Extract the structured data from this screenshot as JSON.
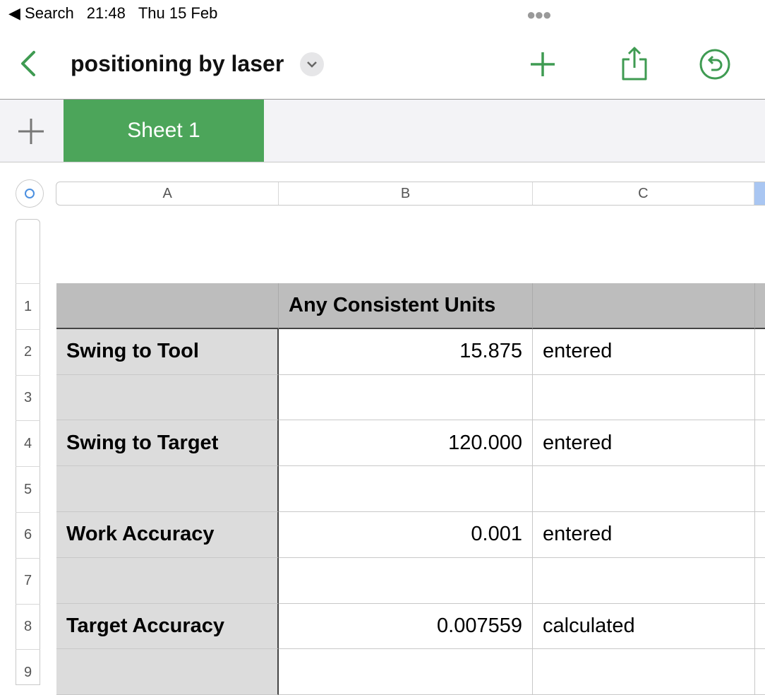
{
  "status": {
    "back_app": "Search",
    "time": "21:48",
    "date": "Thu 15 Feb"
  },
  "toolbar": {
    "title": "positioning by laser",
    "icons": [
      "back-chevron-icon",
      "title-dropdown-icon",
      "plus-icon",
      "share-icon",
      "undo-icon"
    ],
    "accent": "#3f9b52"
  },
  "sheets": {
    "tabs": [
      {
        "label": "Sheet 1",
        "active": true
      }
    ]
  },
  "columns": [
    "A",
    "B",
    "C"
  ],
  "rows": [
    "1",
    "2",
    "3",
    "4",
    "5",
    "6",
    "7",
    "8",
    "9"
  ],
  "table": {
    "header": [
      "",
      "Any Consistent Units",
      ""
    ],
    "body": [
      [
        "Swing to Tool",
        "15.875",
        "entered"
      ],
      [
        "",
        "",
        ""
      ],
      [
        "Swing to Target",
        "120.000",
        "entered"
      ],
      [
        "",
        "",
        ""
      ],
      [
        "Work Accuracy",
        "0.001",
        "entered"
      ],
      [
        "",
        "",
        ""
      ],
      [
        "Target Accuracy",
        "0.007559",
        "calculated"
      ],
      [
        "",
        "",
        ""
      ]
    ]
  }
}
